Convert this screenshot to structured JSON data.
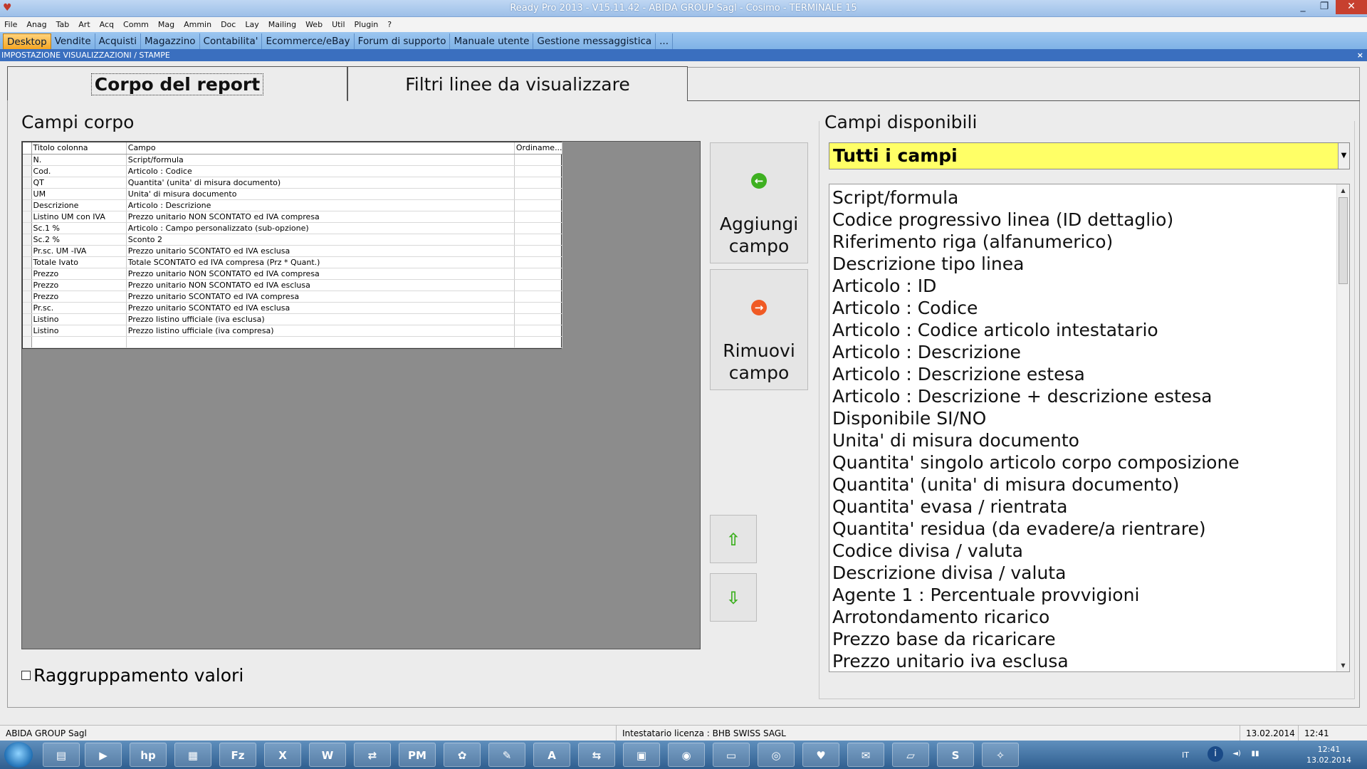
{
  "window": {
    "title": "Ready Pro 2013 - V15.11.42 - ABIDA GROUP Sagl - Cosimo - TERMINALE 15",
    "controls": {
      "minimize": "_",
      "restore": "❐",
      "close": "✕"
    }
  },
  "menu": [
    "File",
    "Anag",
    "Tab",
    "Art",
    "Acq",
    "Comm",
    "Mag",
    "Ammin",
    "Doc",
    "Lay",
    "Mailing",
    "Web",
    "Util",
    "Plugin",
    "?"
  ],
  "module_tabs": [
    "Desktop",
    "Vendite",
    "Acquisti",
    "Magazzino",
    "Contabilita'",
    "Ecommerce/eBay",
    "Forum di supporto",
    "Manuale utente",
    "Gestione messaggistica",
    "..."
  ],
  "active_module_tab": "Desktop",
  "subheader": {
    "title": "IMPOSTAZIONE VISUALIZZAZIONI / STAMPE",
    "close": "×"
  },
  "panel_tabs": {
    "body": "Corpo del report",
    "filters": "Filtri linee da visualizzare"
  },
  "left": {
    "title": "Campi corpo",
    "columns": [
      "Titolo colonna",
      "Campo",
      "Ordiname..."
    ],
    "rows": [
      {
        "title": "N.",
        "field": "Script/formula",
        "order": ""
      },
      {
        "title": "Cod.",
        "field": "Articolo : Codice",
        "order": ""
      },
      {
        "title": "QT",
        "field": "Quantita' (unita' di misura documento)",
        "order": ""
      },
      {
        "title": "UM",
        "field": "Unita' di misura documento",
        "order": ""
      },
      {
        "title": "Descrizione",
        "field": "Articolo : Descrizione",
        "order": ""
      },
      {
        "title": "Listino UM con IVA",
        "field": "Prezzo unitario NON SCONTATO ed IVA compresa",
        "order": ""
      },
      {
        "title": "Sc.1 %",
        "field": "Articolo : Campo personalizzato (sub-opzione)",
        "order": ""
      },
      {
        "title": "Sc.2 %",
        "field": "Sconto 2",
        "order": ""
      },
      {
        "title": "Pr.sc. UM -IVA",
        "field": "Prezzo unitario SCONTATO ed IVA esclusa",
        "order": ""
      },
      {
        "title": "Totale Ivato",
        "field": "Totale SCONTATO ed IVA compresa (Prz * Quant.)",
        "order": ""
      },
      {
        "title": "Prezzo",
        "field": "Prezzo unitario NON SCONTATO ed IVA compresa",
        "order": ""
      },
      {
        "title": "Prezzo",
        "field": "Prezzo unitario NON SCONTATO ed IVA esclusa",
        "order": ""
      },
      {
        "title": "Prezzo",
        "field": "Prezzo unitario SCONTATO ed IVA compresa",
        "order": ""
      },
      {
        "title": "Pr.sc.",
        "field": "Prezzo unitario SCONTATO ed IVA esclusa",
        "order": ""
      },
      {
        "title": "Listino",
        "field": "Prezzo listino ufficiale (iva esclusa)",
        "order": ""
      },
      {
        "title": "Listino",
        "field": "Prezzo listino ufficiale (iva compresa)",
        "order": ""
      },
      {
        "title": "",
        "field": "",
        "order": ""
      }
    ],
    "grouping_label": "Raggruppamento valori"
  },
  "buttons": {
    "add": {
      "line1": "Aggiungi",
      "line2": "campo",
      "icon": "arrow-left-circle-icon",
      "color": "#3eb021"
    },
    "remove": {
      "line1": "Rimuovi",
      "line2": "campo",
      "icon": "arrow-right-circle-icon",
      "color": "#f05a24"
    },
    "move_up_glyph": "⇧",
    "move_down_glyph": "⇩"
  },
  "right": {
    "title": "Campi disponibili",
    "filter_value": "Tutti i campi",
    "filter_color": "#ffff66",
    "fields": [
      "Script/formula",
      "Codice progressivo linea (ID dettaglio)",
      "Riferimento riga (alfanumerico)",
      "Descrizione tipo linea",
      "Articolo : ID",
      "Articolo : Codice",
      "Articolo : Codice articolo intestatario",
      "Articolo : Descrizione",
      "Articolo : Descrizione estesa",
      "Articolo : Descrizione + descrizione estesa",
      "Disponibile SI/NO",
      "Unita' di misura documento",
      "Quantita' singolo articolo corpo composizione",
      "Quantita' (unita' di misura documento)",
      "Quantita' evasa / rientrata",
      "Quantita' residua (da evadere/a rientrare)",
      "Codice divisa / valuta",
      "Descrizione divisa / valuta",
      "Agente 1 : Percentuale provvigioni",
      "Arrotondamento ricarico",
      "Prezzo base da ricaricare",
      "Prezzo unitario iva esclusa"
    ]
  },
  "status": {
    "company": "ABIDA GROUP Sagl",
    "license": "Intestatario licenza : BHB SWISS SAGL",
    "date": "13.02.2014",
    "time": "12:41"
  },
  "taskbar": {
    "apps": [
      "folder-icon",
      "media-player-icon",
      "hp-icon",
      "archive-icon",
      "filezilla-icon",
      "excel-icon",
      "word-icon",
      "network-icon",
      "pm-icon",
      "picasa-icon",
      "gimp-icon",
      "acrobat-icon",
      "teamviewer-icon",
      "remote-desktop-icon",
      "firefox-icon",
      "terminal-icon",
      "chrome-icon",
      "ready-pro-icon",
      "mail-icon",
      "notes-icon",
      "skype-icon",
      "tools-icon"
    ],
    "app_glyphs": [
      "▤",
      "▶",
      "hp",
      "▦",
      "Fz",
      "X",
      "W",
      "⇄",
      "PM",
      "✿",
      "✎",
      "A",
      "⇆",
      "▣",
      "◉",
      "▭",
      "◎",
      "♥",
      "✉",
      "▱",
      "S",
      "✧"
    ],
    "language": "IT",
    "clock_time": "12:41",
    "clock_date": "13.02.2014"
  }
}
